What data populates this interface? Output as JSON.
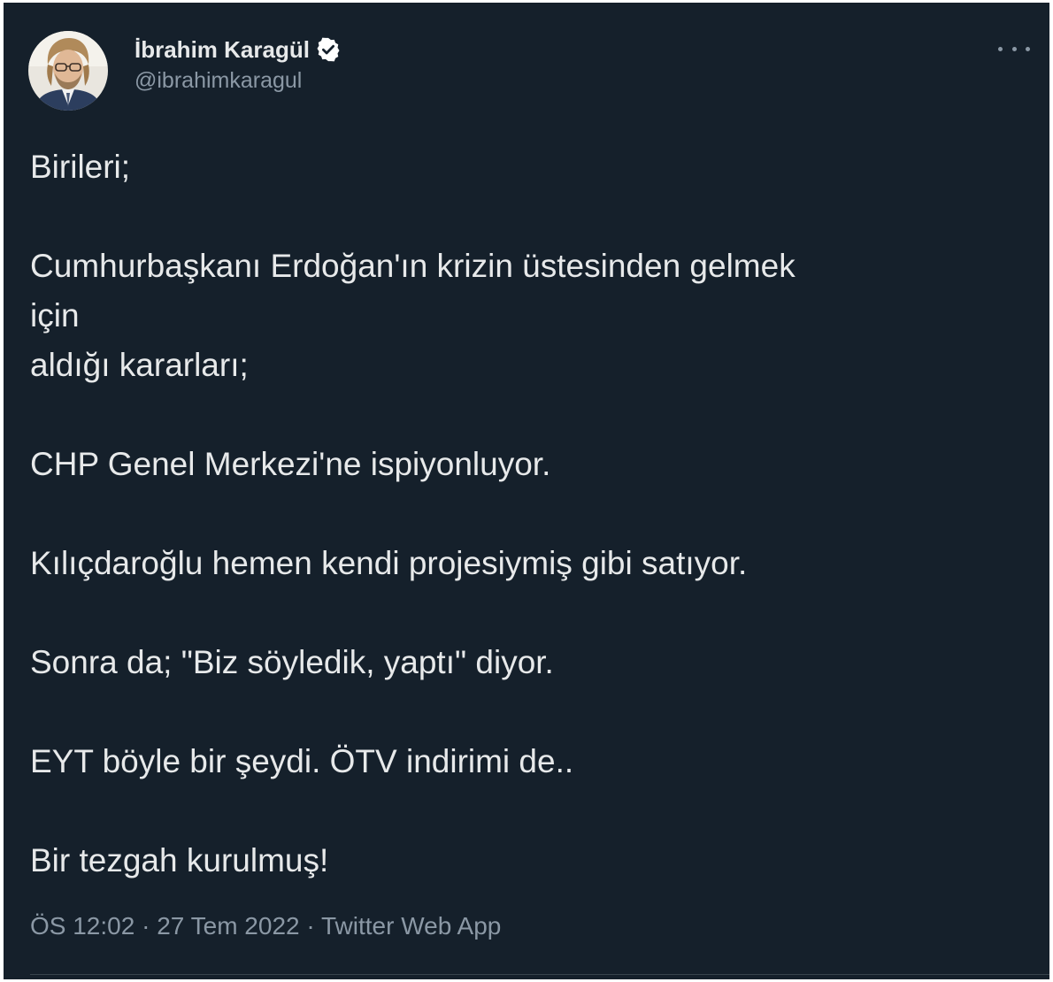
{
  "tweet": {
    "author": {
      "name": "İbrahim Karagül",
      "handle": "@ibrahimkaragul",
      "avatar_icon": "profile-photo",
      "verified_icon": "verified-badge-icon"
    },
    "more_icon": "more-options-icon",
    "lines": {
      "l1": "Birileri;",
      "l2": "Cumhurbaşkanı Erdoğan'ın krizin üstesinden gelmek",
      "l3": "için",
      "l4": "aldığı kararları;",
      "l5": "CHP Genel Merkezi'ne ispiyonluyor.",
      "l6": "Kılıçdaroğlu hemen kendi projesiymiş gibi satıyor.",
      "l7": "Sonra da; \"Biz söyledik, yaptı\" diyor.",
      "l8": "EYT böyle bir şeydi. ÖTV indirimi de..",
      "l9": "Bir tezgah kurulmuş!"
    },
    "meta": {
      "time": "ÖS 12:02",
      "date": "27 Tem 2022",
      "source": "Twitter Web App",
      "separator": "·"
    }
  },
  "colors": {
    "background": "#15202b",
    "text": "#e7e9ea",
    "secondary": "#8b98a5",
    "verified": "#ffffff"
  }
}
